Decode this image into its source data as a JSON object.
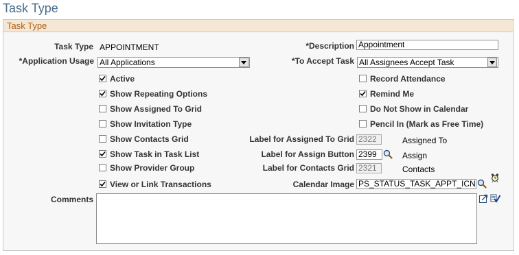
{
  "page": {
    "title": "Task Type"
  },
  "group": {
    "title": "Task Type"
  },
  "fields": {
    "task_type": {
      "label": "Task Type",
      "value": "APPOINTMENT"
    },
    "description": {
      "label": "*Description",
      "value": "Appointment"
    },
    "application_usage": {
      "label": "*Application Usage",
      "value": "All Applications"
    },
    "to_accept_task": {
      "label": "*To Accept Task",
      "value": "All Assignees Accept Task"
    },
    "label_assigned_grid": {
      "label": "Label for Assigned To Grid",
      "value": "2322",
      "desc": "Assigned To"
    },
    "label_assign_button": {
      "label": "Label for Assign Button",
      "value": "2399",
      "desc": "Assign"
    },
    "label_contacts_grid": {
      "label": "Label for Contacts Grid",
      "value": "2321",
      "desc": "Contacts"
    },
    "calendar_image": {
      "label": "Calendar Image",
      "value": "PS_STATUS_TASK_APPT_ICN"
    },
    "comments": {
      "label": "Comments",
      "value": ""
    }
  },
  "checkboxes": {
    "active": {
      "label": "Active",
      "checked": true
    },
    "show_repeating": {
      "label": "Show Repeating Options",
      "checked": true
    },
    "show_assigned_grid": {
      "label": "Show Assigned To Grid",
      "checked": false
    },
    "show_invitation": {
      "label": "Show Invitation Type",
      "checked": false
    },
    "show_contacts": {
      "label": "Show Contacts Grid",
      "checked": false
    },
    "show_task_list": {
      "label": "Show Task in Task List",
      "checked": true
    },
    "show_provider": {
      "label": "Show Provider Group",
      "checked": false
    },
    "view_link": {
      "label": "View or Link Transactions",
      "checked": true
    },
    "record_attendance": {
      "label": "Record Attendance",
      "checked": false
    },
    "remind_me": {
      "label": "Remind Me",
      "checked": true
    },
    "not_show_calendar": {
      "label": "Do Not Show in Calendar",
      "checked": false
    },
    "pencil_in": {
      "label": "Pencil In (Mark as Free Time)",
      "checked": false
    }
  },
  "icons": {
    "lookup": "magnifier-icon",
    "dropdown": "chevron-down-icon",
    "calendar_preview": "alarm-clock-icon",
    "expand": "popup-expand-icon",
    "spellcheck": "spellcheck-icon"
  },
  "colors": {
    "title": "#4a6c8c",
    "group_title": "#b25b14",
    "group_header": "#f4e7d3"
  }
}
